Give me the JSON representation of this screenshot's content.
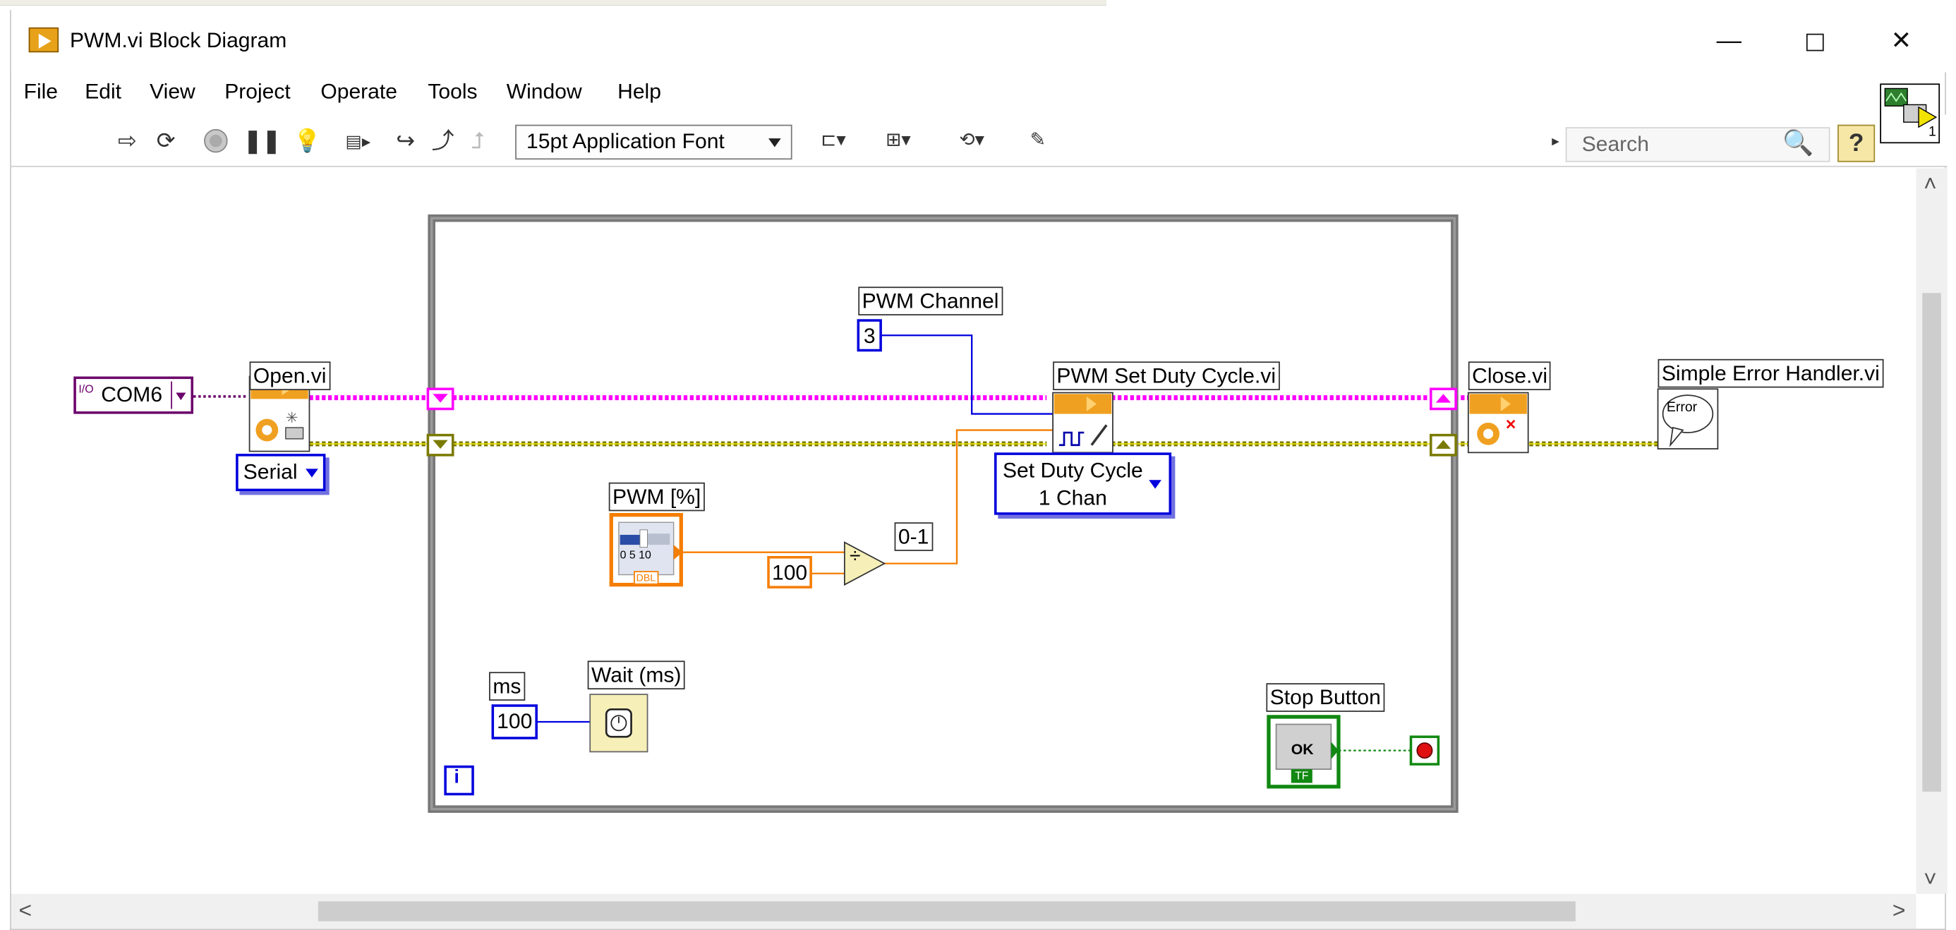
{
  "window": {
    "title": "PWM.vi Block Diagram"
  },
  "menu": [
    "File",
    "Edit",
    "View",
    "Project",
    "Operate",
    "Tools",
    "Window",
    "Help"
  ],
  "toolbar": {
    "font": "15pt Application Font",
    "search_placeholder": "Search",
    "help_glyph": "?",
    "vi_icon_number": "1"
  },
  "diagram": {
    "visa_resource": "COM6",
    "visa_glyph": "I/O",
    "open_vi": "Open.vi",
    "serial_enum": "Serial",
    "pwm_channel_label": "PWM Channel",
    "pwm_channel_value": "3",
    "pwm_set_vi": "PWM Set Duty Cycle.vi",
    "set_duty_enum_line1": "Set Duty Cycle",
    "set_duty_enum_line2": "1 Chan",
    "close_vi": "Close.vi",
    "error_handler_vi": "Simple Error Handler.vi",
    "error_glyph": "Error",
    "pwm_percent_label": "PWM [%]",
    "slider_scale": "0 5 10",
    "dbl_tag": "DBL",
    "divisor_value": "100",
    "divide_glyph": "÷",
    "ratio_label": "0-1",
    "ms_label": "ms",
    "ms_value": "100",
    "wait_vi": "Wait (ms)",
    "stop_label": "Stop Button",
    "ok_text": "OK",
    "tf_tag": "TF",
    "iteration": "i"
  },
  "colors": {
    "visa_wire": "#ff00ff",
    "error_wire": "#8a8a00",
    "numeric_double": "#f57d00",
    "numeric_int": "#0000dd",
    "boolean": "#118811",
    "visa_resource": "#6b006b",
    "loop_border": "#7a7a7a"
  }
}
